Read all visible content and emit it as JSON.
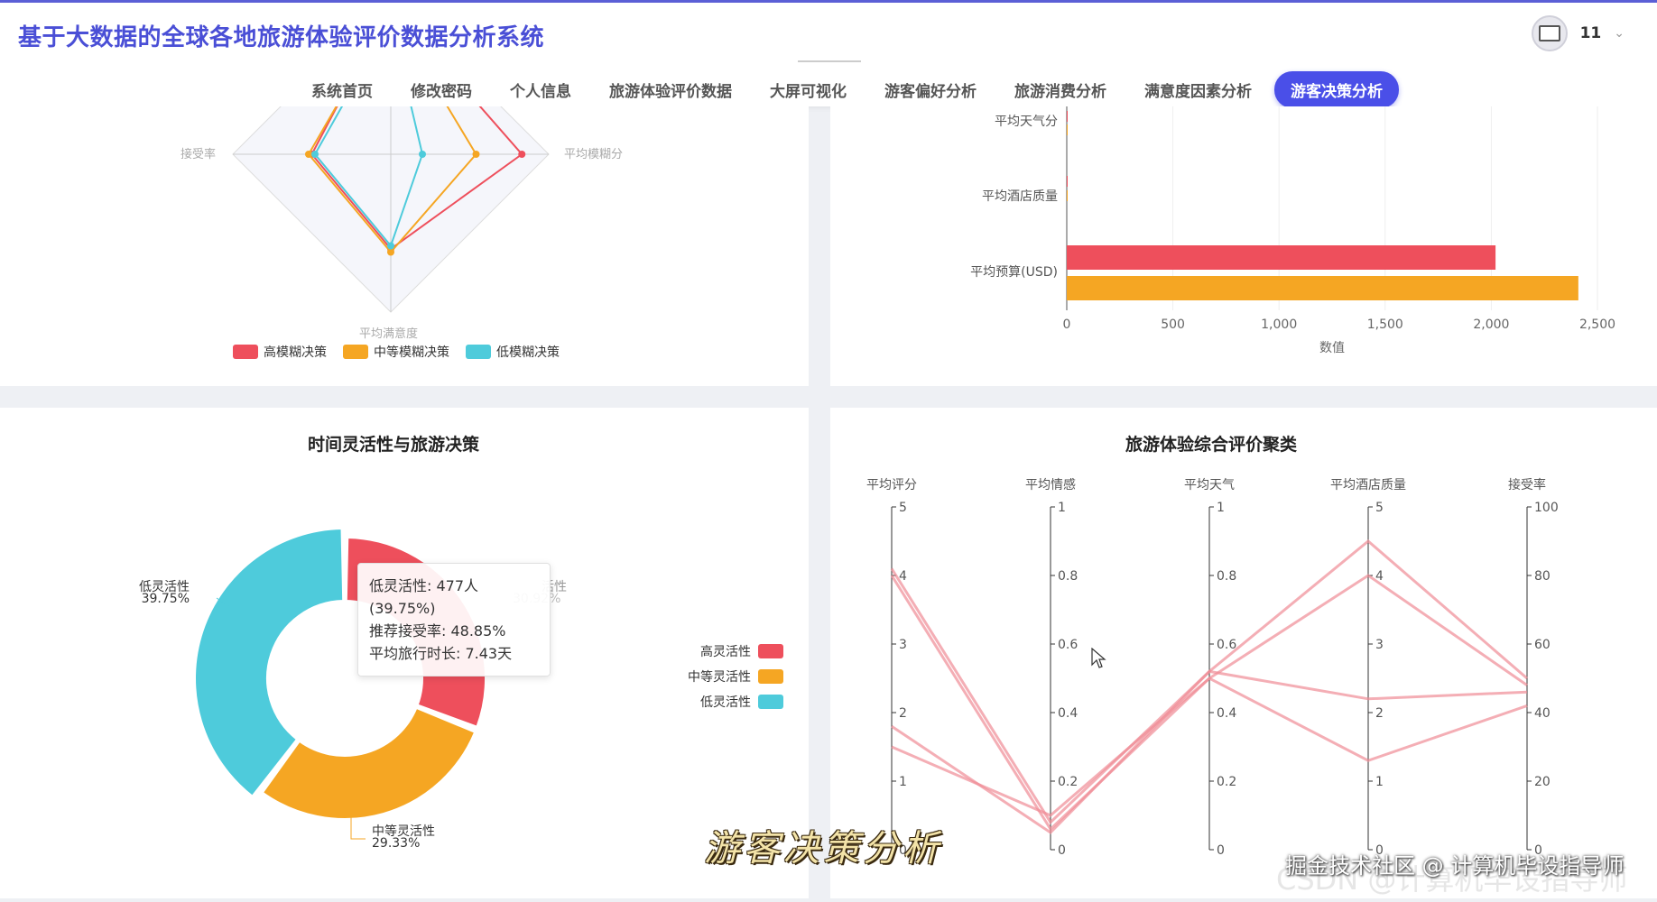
{
  "app": {
    "title": "基于大数据的全球各地旅游体验评价数据分析系统",
    "user": "11"
  },
  "nav": {
    "items": [
      "系统首页",
      "修改密码",
      "个人信息",
      "旅游体验评价数据",
      "大屏可视化",
      "游客偏好分析",
      "旅游消费分析",
      "满意度因素分析"
    ],
    "active": "游客决策分析"
  },
  "radar": {
    "axes": [
      "接受率",
      "平均模糊分",
      "平均满意度"
    ],
    "legend": [
      "高模糊决策",
      "中等模糊决策",
      "低模糊决策"
    ],
    "colors": [
      "#ee4f5c",
      "#f5a623",
      "#4ecbdb"
    ]
  },
  "hbar": {
    "categories": [
      "平均天气分",
      "平均酒店质量",
      "平均预算(USD)"
    ],
    "xticks": [
      "0",
      "500",
      "1,000",
      "1,500",
      "2,000",
      "2,500"
    ],
    "xlabel": "数值"
  },
  "donut": {
    "title": "时间灵活性与旅游决策",
    "labels": {
      "low": {
        "name": "低灵活性",
        "pct": "39.75%"
      },
      "mid": {
        "name": "中等灵活性",
        "pct": "29.33%"
      },
      "high_partial_name": "活性",
      "high_pct": "30.92%"
    },
    "legend": [
      "高灵活性",
      "中等灵活性",
      "低灵活性"
    ],
    "tooltip": {
      "line1": "低灵活性: 477人 (39.75%)",
      "line2": "推荐接受率: 48.85%",
      "line3": "平均旅行时长: 7.43天"
    }
  },
  "parallel": {
    "title": "旅游体验综合评价聚类",
    "axes": [
      "平均评分",
      "平均情感",
      "平均天气",
      "平均酒店质量",
      "接受率"
    ],
    "ticks": [
      [
        "0",
        "1",
        "2",
        "3",
        "4",
        "5"
      ],
      [
        "0",
        "0.2",
        "0.4",
        "0.6",
        "0.8",
        "1"
      ],
      [
        "0",
        "0.2",
        "0.4",
        "0.6",
        "0.8",
        "1"
      ],
      [
        "0",
        "1",
        "2",
        "3",
        "4",
        "5"
      ],
      [
        "0",
        "20",
        "40",
        "60",
        "80",
        "100"
      ]
    ]
  },
  "watermarks": {
    "center": "游客决策分析",
    "right": "掘金技术社区 @ 计算机毕设指导师",
    "right_faint": "CSDN @计算机毕设指导师"
  },
  "chart_data": [
    {
      "type": "radar",
      "axes": [
        "平均模糊分",
        "平均满意度",
        "接受率"
      ],
      "series": [
        {
          "name": "高模糊决策",
          "values": [
            0.83,
            0.6,
            0.5
          ]
        },
        {
          "name": "中等模糊决策",
          "values": [
            0.54,
            0.62,
            0.52
          ]
        },
        {
          "name": "低模糊决策",
          "values": [
            0.2,
            0.58,
            0.48
          ]
        }
      ],
      "legend": [
        "高模糊决策",
        "中等模糊决策",
        "低模糊决策"
      ]
    },
    {
      "type": "bar",
      "orientation": "horizontal",
      "categories": [
        "平均预算(USD)",
        "平均酒店质量",
        "平均天气分"
      ],
      "series": [
        {
          "name": "高模糊决策",
          "values": [
            2020,
            3,
            0.6
          ]
        },
        {
          "name": "中等模糊决策",
          "values": [
            2410,
            3,
            0.6
          ]
        }
      ],
      "xlabel": "数值",
      "xlim": [
        0,
        2500
      ]
    },
    {
      "type": "pie",
      "title": "时间灵活性与旅游决策",
      "categories": [
        "高灵活性",
        "中等灵活性",
        "低灵活性"
      ],
      "values": [
        30.92,
        29.33,
        39.75
      ]
    },
    {
      "type": "line",
      "subtype": "parallel-coordinates",
      "title": "旅游体验综合评价聚类",
      "axes": [
        "平均评分",
        "平均情感",
        "平均天气",
        "平均酒店质量",
        "接受率"
      ],
      "axis_ranges": [
        [
          0,
          5
        ],
        [
          0,
          1
        ],
        [
          0,
          1
        ],
        [
          0,
          5
        ],
        [
          0,
          100
        ]
      ],
      "series": [
        {
          "values": [
            4.1,
            0.08,
            0.52,
            4.5,
            50
          ]
        },
        {
          "values": [
            4.0,
            0.06,
            0.5,
            4.0,
            48
          ]
        },
        {
          "values": [
            1.8,
            0.05,
            0.52,
            2.2,
            46
          ]
        },
        {
          "values": [
            1.5,
            0.1,
            0.5,
            1.3,
            42
          ]
        }
      ]
    }
  ]
}
